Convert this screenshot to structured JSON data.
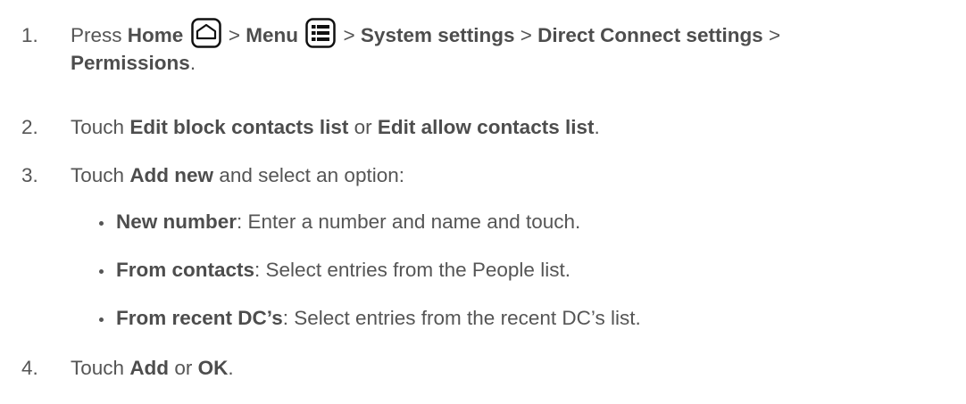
{
  "steps": [
    {
      "number": "1.",
      "press": "Press",
      "home": "Home",
      "sep1": ">",
      "menu": "Menu",
      "sep2": ">",
      "system_settings": "System settings",
      "sep3": ">",
      "dc_settings": "Direct Connect settings",
      "sep4": ">",
      "permissions": "Permissions",
      "period": ".",
      "icons": [
        "home-icon",
        "menu-icon"
      ]
    },
    {
      "number": "2.",
      "touch": "Touch",
      "edit_block": "Edit block contacts list",
      "or": "or",
      "edit_allow": "Edit allow contacts list",
      "period": "."
    },
    {
      "number": "3.",
      "touch": "Touch",
      "add_new": "Add new",
      "rest": "and select an option:",
      "options": [
        {
          "label": "New number",
          "desc": ": Enter a number and name and touch."
        },
        {
          "label": "From contacts",
          "desc": ": Select entries from the People list."
        },
        {
          "label": "From recent DC’s",
          "desc": ": Select entries from the recent DC’s list."
        }
      ]
    },
    {
      "number": "4.",
      "touch": "Touch",
      "add": "Add",
      "or": "or",
      "ok": "OK",
      "period": "."
    }
  ]
}
